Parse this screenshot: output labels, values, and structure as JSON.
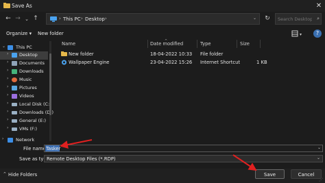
{
  "window": {
    "title": "Save As"
  },
  "nav": {
    "back": "←",
    "forward": "→",
    "up": "↑",
    "history": "⌄"
  },
  "address": {
    "crumbs": [
      "This PC",
      "Desktop"
    ],
    "sep": "›"
  },
  "search": {
    "placeholder": "Search Desktop"
  },
  "toolbar": {
    "organize": "Organize ▾",
    "new_folder": "New folder"
  },
  "sidebar": {
    "items": [
      {
        "label": "This PC",
        "icon": "this-pc-icon",
        "color": "#3c8ee6"
      },
      {
        "label": "Desktop",
        "icon": "desktop-icon",
        "color": "#4aa3f0"
      },
      {
        "label": "Documents",
        "icon": "documents-icon",
        "color": "#8fa3b8"
      },
      {
        "label": "Downloads",
        "icon": "downloads-icon",
        "color": "#45b37b"
      },
      {
        "label": "Music",
        "icon": "music-icon",
        "color": "#e06b3e"
      },
      {
        "label": "Pictures",
        "icon": "pictures-icon",
        "color": "#5aa7e0"
      },
      {
        "label": "Videos",
        "icon": "videos-icon",
        "color": "#9b6fe0"
      },
      {
        "label": "Local Disk (C:)",
        "icon": "drive-icon",
        "color": "#9ab0c4"
      },
      {
        "label": "Downloads (D:)",
        "icon": "drive-icon",
        "color": "#9ab0c4"
      },
      {
        "label": "General (E:)",
        "icon": "drive-icon",
        "color": "#9ab0c4"
      },
      {
        "label": "VMs (F:)",
        "icon": "drive-icon",
        "color": "#9ab0c4"
      },
      {
        "label": "Network",
        "icon": "network-icon",
        "color": "#3c8ee6"
      }
    ]
  },
  "columns": {
    "name": "Name",
    "date": "Date modified",
    "type": "Type",
    "size": "Size"
  },
  "files": [
    {
      "name": "New folder",
      "date": "18-04-2022 10:33",
      "type": "File folder",
      "size": "",
      "color": "#e6b84a"
    },
    {
      "name": "Wallpaper Engine",
      "date": "23-04-2022 15:26",
      "type": "Internet Shortcut",
      "size": "1 KB",
      "color": "#4aa3f0"
    }
  ],
  "form": {
    "filename_label": "File name:",
    "filename_value": "Tasker",
    "savetype_label": "Save as type:",
    "savetype_value": "Remote Desktop Files (*.RDP)"
  },
  "footer": {
    "hide_folders": "Hide Folders",
    "save": "Save",
    "cancel": "Cancel"
  },
  "accent": {
    "arrow": "#e02020",
    "selection": "#3d6fb3"
  }
}
